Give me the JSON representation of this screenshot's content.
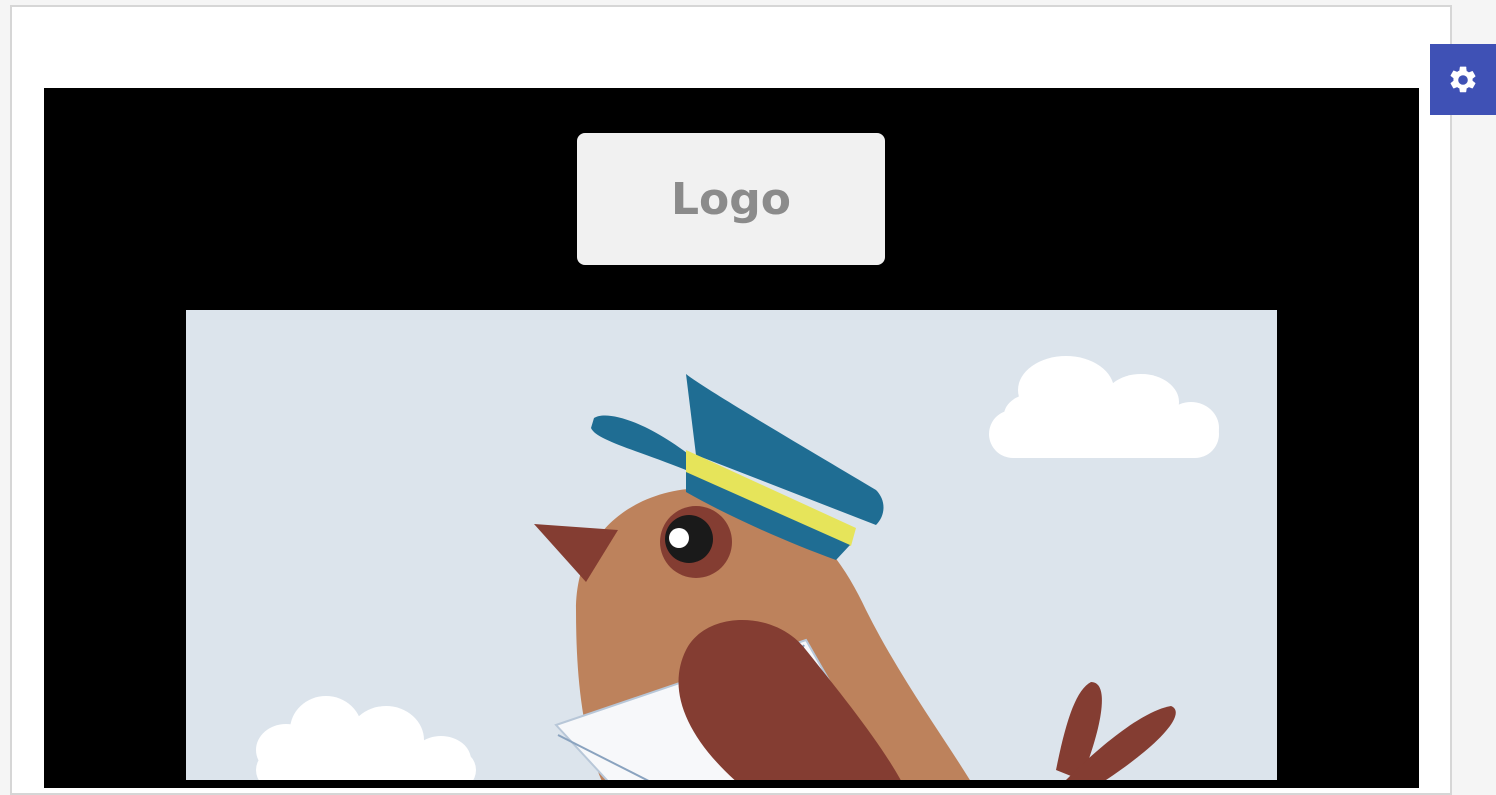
{
  "email": {
    "logo_label": "Logo",
    "background_color": "#000000",
    "hero_image": {
      "icon": "postman-bird-illustration",
      "sky_color": "#dce4ec"
    }
  },
  "toolbar": {
    "settings_icon": "gear-icon",
    "accent_color": "#3f51b5"
  }
}
